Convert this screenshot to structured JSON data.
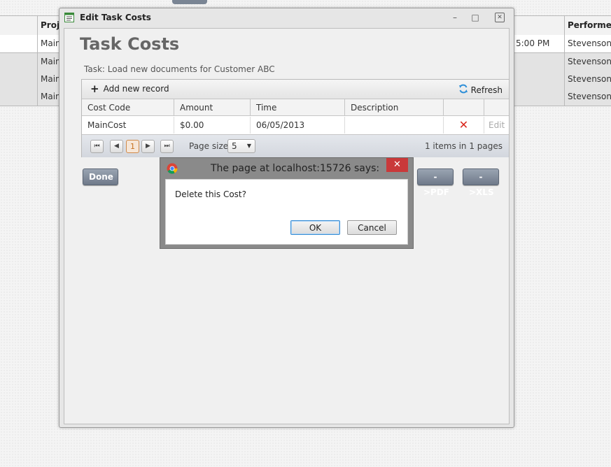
{
  "background": {
    "headers": [
      "Proje",
      "Performer"
    ],
    "rows": [
      {
        "col1": "Main",
        "time": "5:00 PM",
        "performer": "Stevenson, A"
      },
      {
        "col1": "Main",
        "time": "",
        "performer": "Stevenson, A"
      },
      {
        "col1": "Main",
        "time": "",
        "performer": "Stevenson, A"
      },
      {
        "col1": "Main",
        "time": "",
        "performer": "Stevenson, A"
      }
    ]
  },
  "window": {
    "title": "Edit Task Costs",
    "minimize": "–",
    "maximize": "□",
    "close": "✕"
  },
  "page": {
    "title": "Task Costs",
    "task_label": "Task: Load new documents for Customer ABC"
  },
  "grid": {
    "add_label": "Add new record",
    "refresh_label": "Refresh",
    "columns": [
      "Cost Code",
      "Amount",
      "Time",
      "Description",
      "",
      ""
    ],
    "rows": [
      {
        "cost_code": "MainCost",
        "amount": "$0.00",
        "time": "06/05/2013",
        "description": "",
        "delete": "✕",
        "edit": "Edit"
      }
    ],
    "pager": {
      "first": "⏮",
      "prev": "◀",
      "current": "1",
      "next": "▶",
      "last": "⏭",
      "page_size_label": "Page size:",
      "page_size": "5",
      "info": "1 items in 1 pages"
    }
  },
  "buttons": {
    "done": "Done",
    "pdf": "->PDF",
    "xls": "->XLS"
  },
  "dialog": {
    "title": "The page at localhost:15726 says:",
    "message": "Delete this Cost?",
    "ok": "OK",
    "cancel": "Cancel",
    "close": "✕"
  },
  "colors": {
    "accent_button": "#7a8594",
    "delete_icon": "#d9261c",
    "refresh_icon": "#2f8fd8",
    "dialog_close": "#c9393a"
  }
}
